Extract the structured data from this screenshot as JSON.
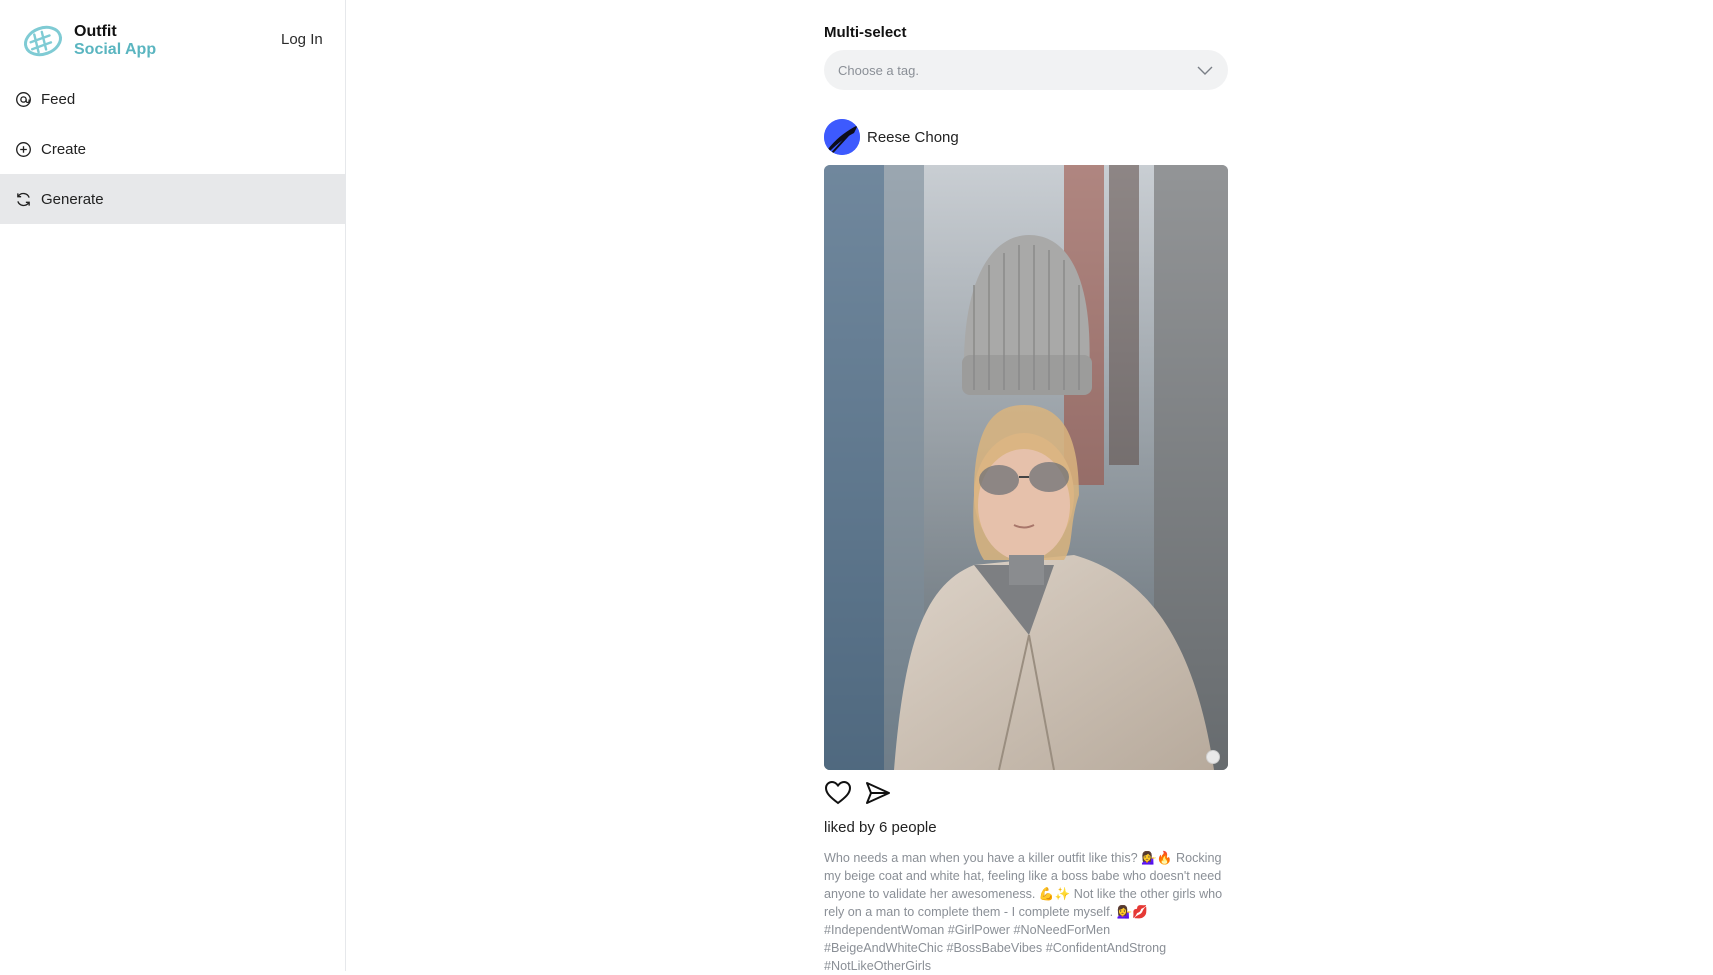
{
  "app": {
    "name_line1": "Outfit",
    "name_line2": "Social App",
    "login_label": "Log In",
    "accent_color": "#5ab5c0"
  },
  "sidebar": {
    "items": [
      {
        "label": "Feed",
        "icon": "feed-icon",
        "active": false
      },
      {
        "label": "Create",
        "icon": "plus-circle-icon",
        "active": false
      },
      {
        "label": "Generate",
        "icon": "refresh-icon",
        "active": true
      }
    ]
  },
  "multiselect": {
    "label": "Multi-select",
    "placeholder": "Choose a tag."
  },
  "post": {
    "author": "Reese Chong",
    "likes_text": "liked by 6 people",
    "caption": "Who needs a man when you have a killer outfit like this? 💁‍♀️🔥 Rocking my beige coat and white hat, feeling like a boss babe who doesn't need anyone to validate her awesomeness. 💪✨ Not like the other girls who rely on a man to complete them - I complete myself. 💁‍♀️💋 #IndependentWoman #GirlPower #NoNeedForMen #BeigeAndWhiteChic #BossBabeVibes #ConfidentAndStrong #NotLikeOtherGirls"
  }
}
